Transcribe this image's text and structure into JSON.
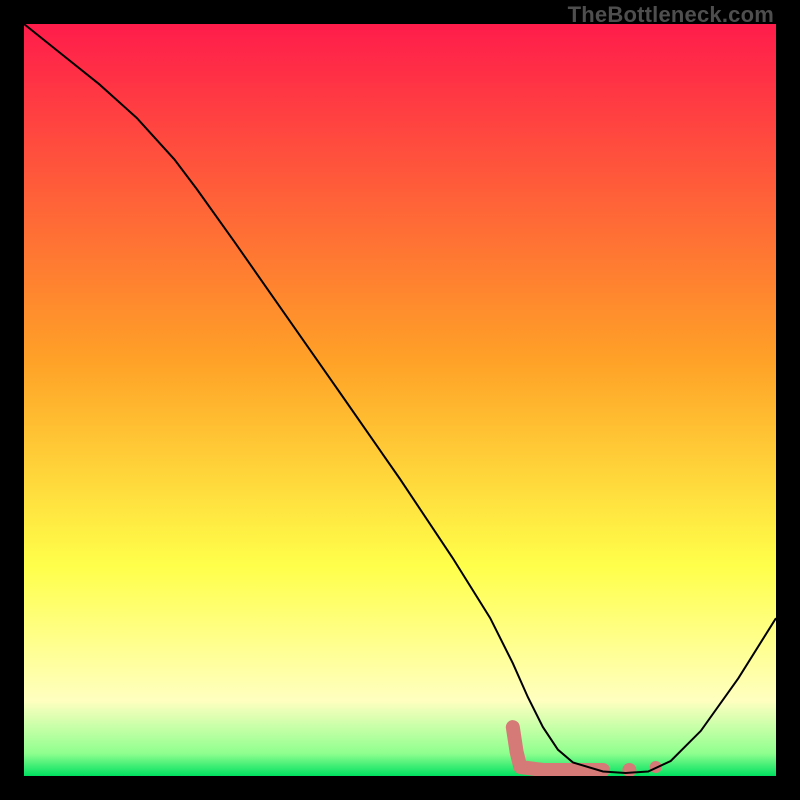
{
  "watermark": "TheBottleneck.com",
  "chart_data": {
    "type": "line",
    "title": "",
    "xlabel": "",
    "ylabel": "",
    "xlim": [
      0,
      100
    ],
    "ylim": [
      0,
      100
    ],
    "background_gradient": {
      "stops": [
        {
          "pos": 0.0,
          "color": "#ff1c4b"
        },
        {
          "pos": 0.45,
          "color": "#ffa227"
        },
        {
          "pos": 0.72,
          "color": "#ffff4a"
        },
        {
          "pos": 0.9,
          "color": "#ffffc0"
        },
        {
          "pos": 0.97,
          "color": "#8fff8f"
        },
        {
          "pos": 1.0,
          "color": "#00e060"
        }
      ]
    },
    "series": [
      {
        "name": "bottleneck-curve",
        "color": "#000000",
        "width": 2,
        "x": [
          0,
          5,
          10,
          15,
          20,
          23,
          28,
          35,
          42,
          50,
          57,
          62,
          65,
          67,
          69,
          71,
          73,
          77,
          80,
          83,
          86,
          90,
          95,
          100
        ],
        "y": [
          100,
          96,
          92,
          87.5,
          82,
          78,
          71,
          61,
          51,
          39.5,
          29,
          21,
          15,
          10.5,
          6.5,
          3.5,
          1.8,
          0.6,
          0.4,
          0.6,
          2,
          6,
          13,
          21
        ]
      }
    ],
    "annotations": [
      {
        "name": "optimal-range-marker",
        "type": "thick-polyline",
        "color": "#d57a77",
        "width": 14,
        "cap": "round",
        "points_x": [
          65,
          65.5,
          66,
          69,
          73,
          77
        ],
        "points_y": [
          6.5,
          3.2,
          1.2,
          0.8,
          0.8,
          0.8
        ]
      },
      {
        "name": "optimal-dot-1",
        "type": "dot",
        "color": "#d57a77",
        "r": 7,
        "x": 80.5,
        "y": 0.8
      },
      {
        "name": "optimal-dot-2",
        "type": "dot",
        "color": "#d57a77",
        "r": 6,
        "x": 84,
        "y": 1.2
      }
    ]
  }
}
